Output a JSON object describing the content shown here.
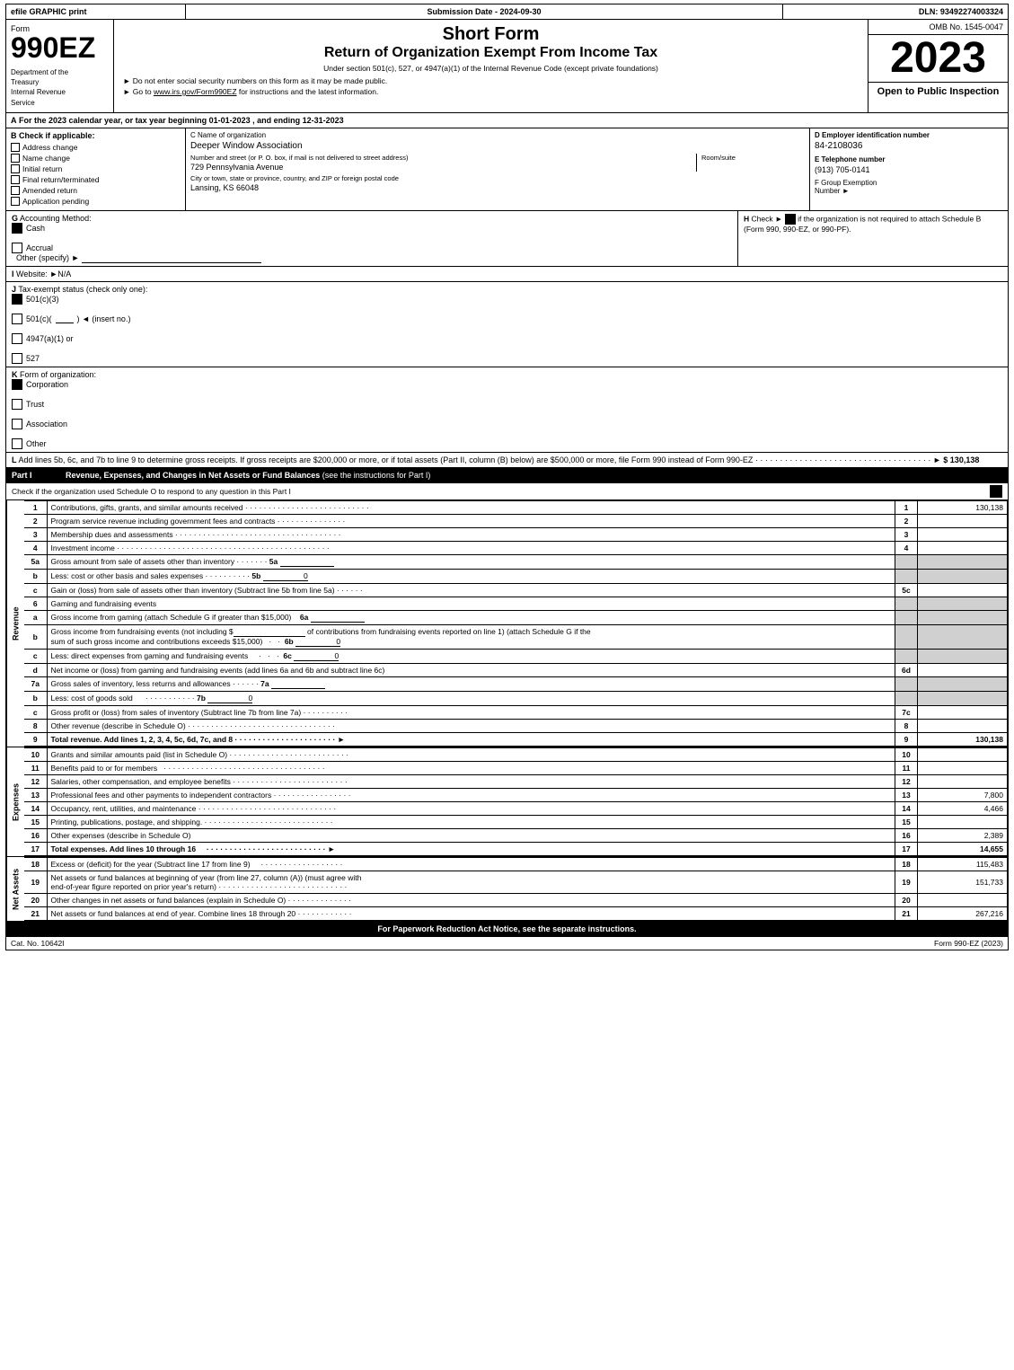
{
  "header": {
    "efile": "efile GRAPHIC print",
    "submission_label": "Submission Date - 2024-09-30",
    "dln": "DLN: 93492274003324",
    "form_label": "Form",
    "form_number": "990EZ",
    "dept_line1": "Department of the",
    "dept_line2": "Treasury",
    "dept_line3": "Internal Revenue",
    "dept_line4": "Service",
    "short_form": "Short Form",
    "return_title": "Return of Organization Exempt From Income Tax",
    "under_section": "Under section 501(c), 527, or 4947(a)(1) of the Internal Revenue Code (except private foundations)",
    "bullet1": "► Do not enter social security numbers on this form as it may be made public.",
    "bullet2": "► Go to www.irs.gov/Form990EZ for instructions and the latest information.",
    "omb": "OMB No. 1545-0047",
    "year": "2023",
    "open_to_public": "Open to Public Inspection"
  },
  "section_a": {
    "label": "A",
    "text": "For the 2023 calendar year, or tax year beginning 01-01-2023 , and ending 12-31-2023"
  },
  "section_b": {
    "label": "B",
    "check_label": "Check if applicable:",
    "checks": [
      {
        "label": "Address change",
        "checked": false
      },
      {
        "label": "Name change",
        "checked": false
      },
      {
        "label": "Initial return",
        "checked": false
      },
      {
        "label": "Final return/terminated",
        "checked": false
      },
      {
        "label": "Amended return",
        "checked": false
      },
      {
        "label": "Application pending",
        "checked": false
      }
    ],
    "c_label": "C Name of organization",
    "org_name": "Deeper Window Association",
    "address_label": "Number and street (or P. O. box, if mail is not delivered to street address)",
    "address_value": "729 Pennsylvania Avenue",
    "room_label": "Room/suite",
    "room_value": "",
    "city_label": "City or town, state or province, country, and ZIP or foreign postal code",
    "city_value": "Lansing, KS  66048",
    "d_label": "D Employer identification number",
    "ein": "84-2108036",
    "e_label": "E Telephone number",
    "telephone": "(913) 705-0141",
    "f_label": "F Group Exemption",
    "f_label2": "Number",
    "f_arrow": "►"
  },
  "section_g": {
    "label": "G",
    "text": "Accounting Method:",
    "cash_checked": true,
    "cash_label": "Cash",
    "accrual_checked": false,
    "accrual_label": "Accrual",
    "other_label": "Other (specify) ►",
    "line": "___________________________"
  },
  "section_h": {
    "label": "H",
    "text": "Check ►",
    "checkbox_checked": true,
    "rest": "if the organization is not required to attach Schedule B (Form 990, 990-EZ, or 990-PF)."
  },
  "section_i": {
    "label": "I",
    "text": "Website: ►N/A"
  },
  "section_j": {
    "label": "J",
    "text": "Tax-exempt status (check only one):",
    "c3_checked": true,
    "c3_label": "501(c)(3)",
    "cc_checked": false,
    "cc_label": "501(c)(",
    "insert": ") ◄ (insert no.)",
    "c4947_checked": false,
    "c4947_label": "4947(a)(1) or",
    "c527_checked": false,
    "c527_label": "527"
  },
  "section_k": {
    "label": "K",
    "text": "Form of organization:",
    "corp_checked": true,
    "corp_label": "Corporation",
    "trust_checked": false,
    "trust_label": "Trust",
    "assoc_checked": false,
    "assoc_label": "Association",
    "other_checked": false,
    "other_label": "Other"
  },
  "section_l": {
    "label": "L",
    "text": "Add lines 5b, 6c, and 7b to line 9 to determine gross receipts. If gross receipts are $200,000 or more, or if total assets (Part II, column (B) below) are $500,000 or more, file Form 990 instead of Form 990-EZ",
    "dots": "· · · · · · · · · · · · · · · · · · · · · · · · · · · · · · · · · · · ·",
    "arrow": "►",
    "value": "$ 130,138"
  },
  "part_i": {
    "label": "Part I",
    "title": "Revenue, Expenses, and Changes in Net Assets or Fund Balances",
    "title_note": "(see the instructions for Part I)",
    "schedule_o_check": "Check if the organization used Schedule O to respond to any question in this Part I",
    "checkbox_checked": true,
    "rows": [
      {
        "num": "1",
        "label": "Contributions, gifts, grants, and similar amounts received",
        "dots": true,
        "line_num": "1",
        "value": "130,138"
      },
      {
        "num": "2",
        "label": "Program service revenue including government fees and contracts",
        "dots": true,
        "line_num": "2",
        "value": ""
      },
      {
        "num": "3",
        "label": "Membership dues and assessments",
        "dots": true,
        "line_num": "3",
        "value": ""
      },
      {
        "num": "4",
        "label": "Investment income",
        "dots": true,
        "line_num": "4",
        "value": ""
      },
      {
        "num": "5a",
        "label": "Gross amount from sale of assets other than inventory",
        "dots": "· · · · · · ·",
        "sub_num": "5a",
        "sub_value": ""
      },
      {
        "num": "b",
        "label": "Less: cost or other basis and sales expenses",
        "dots": "· · · · · · · · · ·",
        "sub_num": "5b",
        "sub_value": "0"
      },
      {
        "num": "c",
        "label": "Gain or (loss) from sale of assets other than inventory (Subtract line 5b from line 5a)",
        "dots": "· · · · · ·",
        "line_num": "5c",
        "value": ""
      },
      {
        "num": "6",
        "label": "Gaming and fundraising events",
        "dots": false,
        "line_num": "",
        "value": ""
      },
      {
        "num": "a",
        "label": "Gross income from gaming (attach Schedule G if greater than $15,000)",
        "sub_num": "6a",
        "sub_value": ""
      },
      {
        "num": "b",
        "label": "Gross income from fundraising events (not including $_____________ of contributions from fundraising events reported on line 1) (attach Schedule G if the sum of such gross income and contributions exceeds $15,000)",
        "sub_num": "6b",
        "sub_value": "0",
        "indent": true
      },
      {
        "num": "c",
        "label": "Less: direct expenses from gaming and fundraising events",
        "dots_short": "· · ·",
        "sub_num": "6c",
        "sub_value": "0"
      },
      {
        "num": "d",
        "label": "Net income or (loss) from gaming and fundraising events (add lines 6a and 6b and subtract line 6c)",
        "line_num": "6d",
        "value": ""
      },
      {
        "num": "7a",
        "label": "Gross sales of inventory, less returns and allowances",
        "dots": "· · · · · ·",
        "sub_num": "7a",
        "sub_value": ""
      },
      {
        "num": "b",
        "label": "Less: cost of goods sold",
        "dots": "· · · · · · · · · · · ·",
        "sub_num": "7b",
        "sub_value": "0"
      },
      {
        "num": "c",
        "label": "Gross profit or (loss) from sales of inventory (Subtract line 7b from line 7a)",
        "dots": "· · · · · · · · · ·",
        "line_num": "7c",
        "value": ""
      },
      {
        "num": "8",
        "label": "Other revenue (describe in Schedule O)",
        "dots": true,
        "line_num": "8",
        "value": ""
      },
      {
        "num": "9",
        "label": "Total revenue. Add lines 1, 2, 3, 4, 5c, 6d, 7c, and 8",
        "dots": true,
        "arrow": "►",
        "line_num": "9",
        "value": "130,138",
        "bold": true
      }
    ]
  },
  "expenses": {
    "rows": [
      {
        "num": "10",
        "label": "Grants and similar amounts paid (list in Schedule O)",
        "dots": true,
        "line_num": "10",
        "value": ""
      },
      {
        "num": "11",
        "label": "Benefits paid to or for members",
        "dots": true,
        "line_num": "11",
        "value": ""
      },
      {
        "num": "12",
        "label": "Salaries, other compensation, and employee benefits",
        "dots": true,
        "line_num": "12",
        "value": ""
      },
      {
        "num": "13",
        "label": "Professional fees and other payments to independent contractors",
        "dots": true,
        "line_num": "13",
        "value": "7,800"
      },
      {
        "num": "14",
        "label": "Occupancy, rent, utilities, and maintenance",
        "dots": true,
        "line_num": "14",
        "value": "4,466"
      },
      {
        "num": "15",
        "label": "Printing, publications, postage, and shipping.",
        "dots": true,
        "line_num": "15",
        "value": ""
      },
      {
        "num": "16",
        "label": "Other expenses (describe in Schedule O)",
        "dots": false,
        "line_num": "16",
        "value": "2,389"
      },
      {
        "num": "17",
        "label": "Total expenses. Add lines 10 through 16",
        "dots": true,
        "arrow": "►",
        "line_num": "17",
        "value": "14,655",
        "bold": true
      }
    ]
  },
  "net_assets": {
    "rows": [
      {
        "num": "18",
        "label": "Excess or (deficit) for the year (Subtract line 17 from line 9)",
        "dots": true,
        "line_num": "18",
        "value": "115,483"
      },
      {
        "num": "19",
        "label": "Net assets or fund balances at beginning of year (from line 27, column (A)) (must agree with end-of-year figure reported on prior year's return)",
        "dots": true,
        "line_num": "19",
        "value": "151,733"
      },
      {
        "num": "20",
        "label": "Other changes in net assets or fund balances (explain in Schedule O)",
        "dots": true,
        "line_num": "20",
        "value": ""
      },
      {
        "num": "21",
        "label": "Net assets or fund balances at end of year. Combine lines 18 through 20",
        "dots": true,
        "line_num": "21",
        "value": "267,216"
      }
    ]
  },
  "footer": {
    "paperwork": "For Paperwork Reduction Act Notice, see the separate instructions.",
    "cat": "Cat. No. 10642I",
    "form": "Form 990-EZ (2023)"
  }
}
